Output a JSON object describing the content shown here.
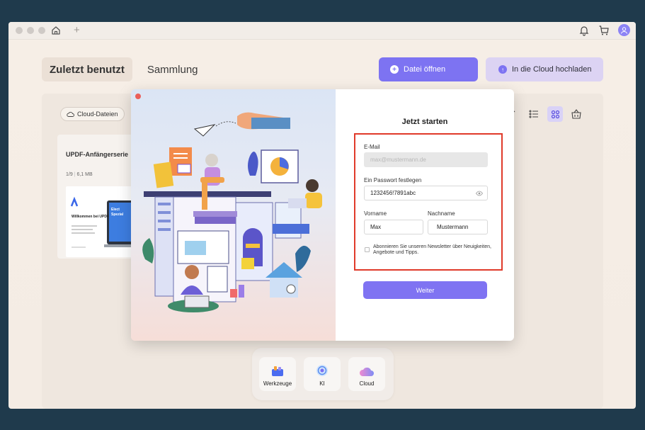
{
  "titlebar": {
    "icons": [
      "home-icon",
      "plus-icon",
      "bell-icon",
      "cart-icon",
      "user-icon"
    ]
  },
  "tabs": [
    {
      "label": "Zuletzt benutzt",
      "active": true
    },
    {
      "label": "Sammlung",
      "active": false
    }
  ],
  "actions": {
    "open_label": "Datei öffnen",
    "cloud_label": "In die Cloud hochladen"
  },
  "panel": {
    "cloud_chip": "Cloud-Dateien",
    "doc": {
      "title": "UPDF-Anfängerserie",
      "pages": "1/9",
      "size": "6,1 MB",
      "thumb_heading": "Willkommen bei UPDF",
      "thumb_sub": "Spezial",
      "thumb_side": "Elect"
    }
  },
  "dock": [
    {
      "label": "Werkzeuge",
      "icon": "toolbox-icon"
    },
    {
      "label": "KI",
      "icon": "ai-icon"
    },
    {
      "label": "Cloud",
      "icon": "cloud-icon"
    }
  ],
  "modal": {
    "title": "Jetzt starten",
    "email_label": "E-Mail",
    "email_placeholder": "max@mustermann.de",
    "password_label": "Ein Passwort festlegen",
    "password_value": "1232456!7891abc",
    "firstname_label": "Vorname",
    "firstname_value": "Max",
    "lastname_label": "Nachname",
    "lastname_value": "Mustermann",
    "newsletter_text": "Abonnieren Sie unseren Newsletter über Neuigkeiten, Angebote und Tipps.",
    "submit_label": "Weiter"
  },
  "colors": {
    "accent": "#7d73f2",
    "highlight_border": "#e03a2a",
    "background": "#1f3a4c"
  }
}
